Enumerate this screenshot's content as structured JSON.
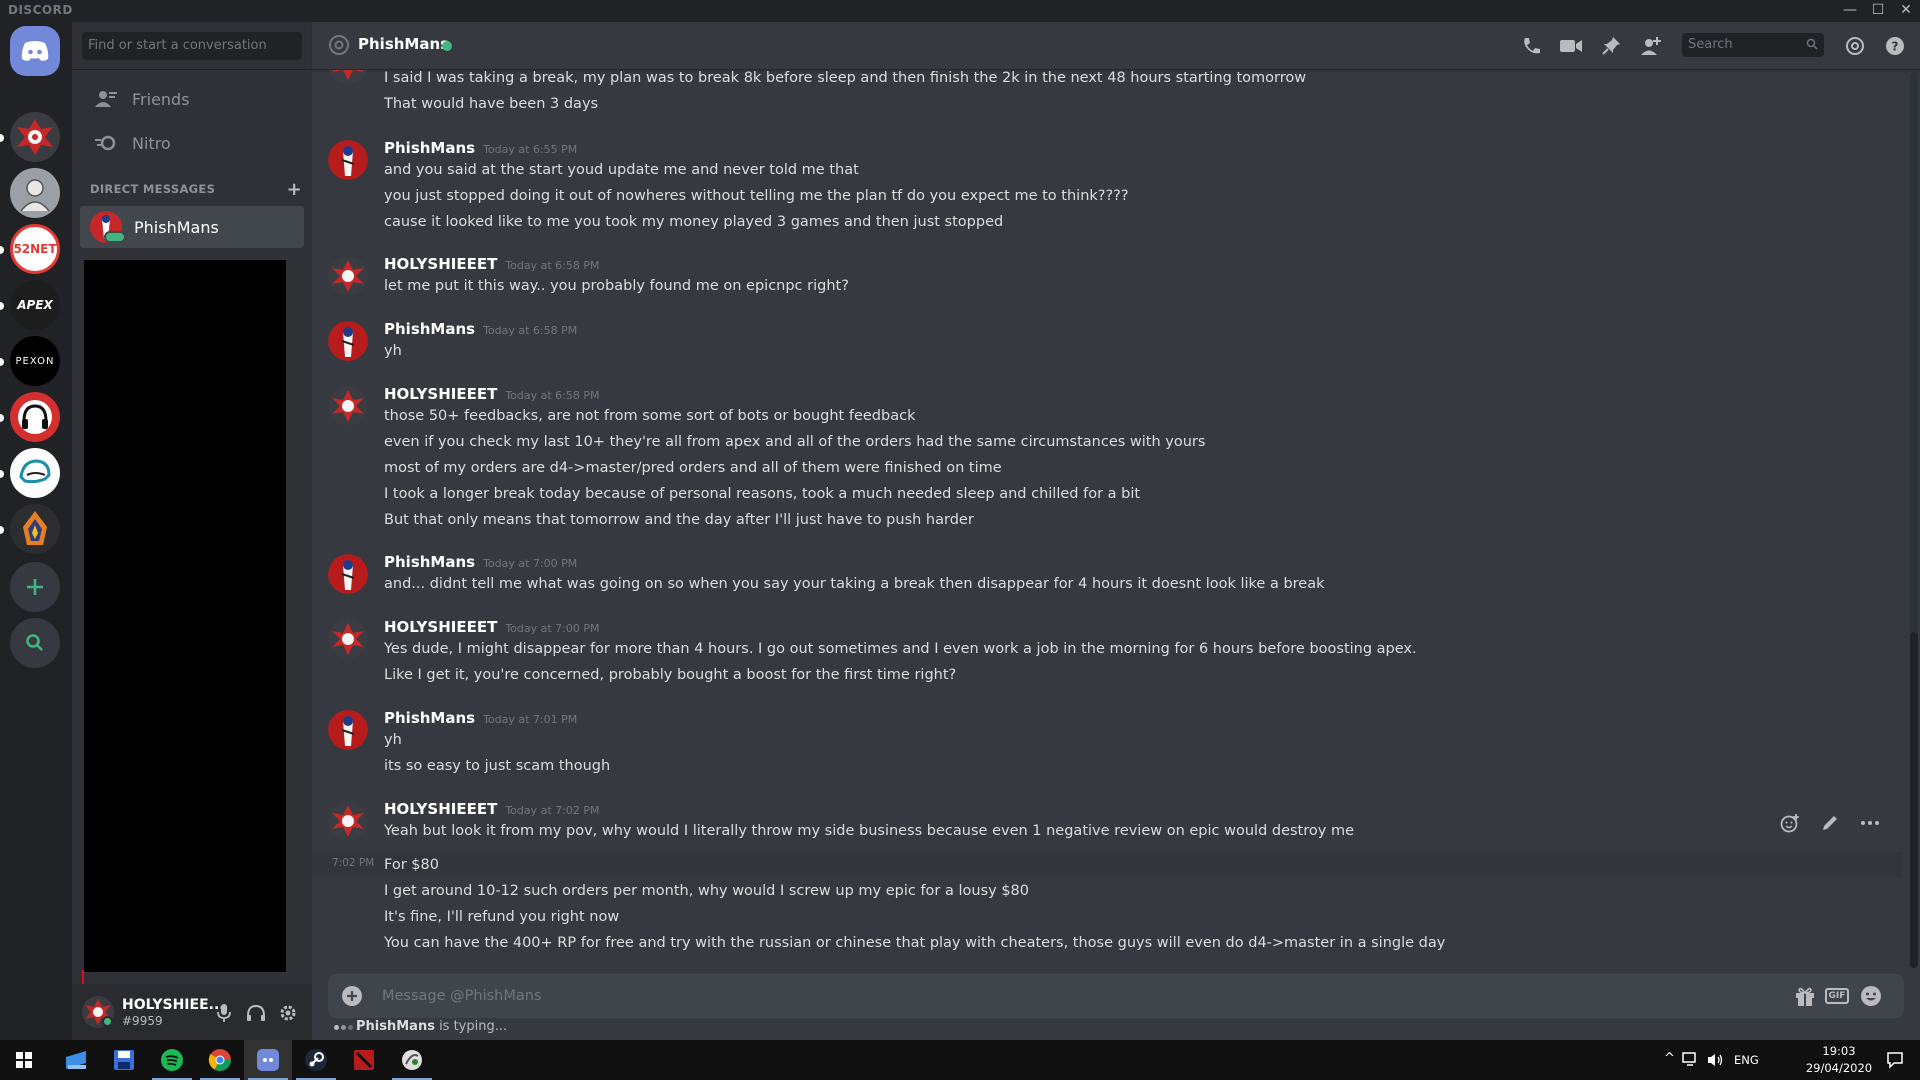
{
  "app": {
    "brand": "DISCORD",
    "window_controls": [
      "—",
      "☐",
      "✕"
    ]
  },
  "sidebar": {
    "search_placeholder": "Find or start a conversation",
    "nav": [
      {
        "label": "Friends",
        "icon": "friends-icon"
      },
      {
        "label": "Nitro",
        "icon": "nitro-icon"
      }
    ],
    "dm_header": "DIRECT MESSAGES",
    "active_dm": "PhishMans"
  },
  "servers": [
    {
      "name": "home",
      "icon": "discord-logo-icon",
      "color": "#7289da"
    },
    {
      "name": "server-1",
      "icon": "red-emblem-icon",
      "color": "#c42b2b"
    },
    {
      "name": "server-2",
      "icon": "avatar-sketch-icon",
      "color": "#9aa0a6"
    },
    {
      "name": "server-52net",
      "label": "52NET",
      "color": "#e53935"
    },
    {
      "name": "server-apex",
      "label": "APEX",
      "color": "#c62828"
    },
    {
      "name": "server-pexon",
      "label": "PEXON",
      "color": "#000000"
    },
    {
      "name": "server-headset",
      "icon": "headset-icon",
      "color": "#d32f2f"
    },
    {
      "name": "server-cap",
      "icon": "cap-icon",
      "color": "#1b8ea8"
    },
    {
      "name": "server-flame",
      "icon": "flame-icon",
      "color": "#e67e22"
    }
  ],
  "user": {
    "name": "HOLYSHIEE...",
    "tag": "#9959"
  },
  "header": {
    "title": "PhishMans",
    "search_placeholder": "Search",
    "status_color": "#43b581"
  },
  "messages": [
    {
      "author": "",
      "time": "",
      "lines": [
        "I said I was taking a break, my plan was to break 8k before sleep and then finish the 2k in the next 48 hours starting tomorrow",
        "That would have been 3 days"
      ]
    },
    {
      "author": "PhishMans",
      "time": "Today at 6:55 PM",
      "lines": [
        "and you said at the start youd update me and never told me that",
        "you just stopped doing it out of nowheres without telling me the plan tf do you expect me to think????",
        "cause it looked like to me you took my money played 3 games and then just stopped"
      ]
    },
    {
      "author": "HOLYSHIEEET",
      "time": "Today at 6:58 PM",
      "lines": [
        "let me put it this way.. you probably found me on epicnpc right?"
      ]
    },
    {
      "author": "PhishMans",
      "time": "Today at 6:58 PM",
      "lines": [
        "yh"
      ]
    },
    {
      "author": "HOLYSHIEEET",
      "time": "Today at 6:58 PM",
      "lines": [
        "those 50+ feedbacks, are not from some sort of bots or bought feedback",
        "even if you check my last 10+ they're all from apex and all of the orders had the same circumstances with yours",
        "most of my orders are d4->master/pred orders and all of them were finished on time",
        "I took a longer break today because of personal reasons, took a much needed sleep and chilled for a bit",
        "But that only means that tomorrow and the day after I'll just have to push harder"
      ]
    },
    {
      "author": "PhishMans",
      "time": "Today at 7:00 PM",
      "lines": [
        "and... didnt tell me what was going on so when you say your taking a break then disappear for 4 hours it doesnt look like a break"
      ]
    },
    {
      "author": "HOLYSHIEEET",
      "time": "Today at 7:00 PM",
      "lines": [
        "Yes dude, I might disappear for more than 4 hours. I go out sometimes and I even work a job in the morning for 6 hours before boosting apex.",
        "Like I get it, you're concerned, probably bought a boost for the first time right?"
      ]
    },
    {
      "author": "PhishMans",
      "time": "Today at 7:01 PM",
      "lines": [
        "yh",
        "its so easy to just scam though"
      ]
    },
    {
      "author": "HOLYSHIEEET",
      "time": "Today at 7:02 PM",
      "lines": [
        "Yeah but look it from my pov, why would I literally throw my side business because even 1 negative review on epic would destroy me",
        "For $80",
        "I get around 10-12 such orders per month, why would I screw up my epic for a lousy $80",
        "It's fine, I'll refund you right now",
        "You can have the 400+ RP for free and try with the russian or chinese that play with cheaters, those guys will even do d4->master in a single day"
      ]
    }
  ],
  "hover_timestamp": "7:02 PM",
  "composer": {
    "placeholder": "Message @PhishMans",
    "gif_label": "GIF"
  },
  "typing": {
    "user": "PhishMans",
    "text": " is typing..."
  },
  "taskbar": {
    "lang": "ENG",
    "time": "19:03",
    "date": "29/04/2020"
  }
}
